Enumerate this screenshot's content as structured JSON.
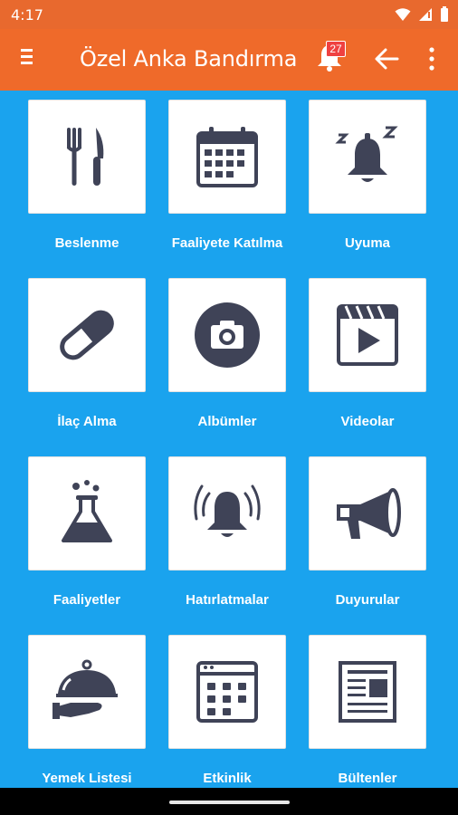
{
  "status": {
    "time": "4:17"
  },
  "appbar": {
    "title": "Özel Anka Bandırma",
    "notification_count": "27"
  },
  "tiles": [
    {
      "label": "Beslenme",
      "icon": "utensils-icon"
    },
    {
      "label": "Faaliyete Katılma",
      "icon": "calendar-icon"
    },
    {
      "label": "Uyuma",
      "icon": "sleep-bell-icon"
    },
    {
      "label": "İlaç Alma",
      "icon": "pill-icon"
    },
    {
      "label": "Albümler",
      "icon": "camera-icon"
    },
    {
      "label": "Videolar",
      "icon": "video-icon"
    },
    {
      "label": "Faaliyetler",
      "icon": "flask-icon"
    },
    {
      "label": "Hatırlatmalar",
      "icon": "alarm-bell-icon"
    },
    {
      "label": "Duyurular",
      "icon": "megaphone-icon"
    },
    {
      "label": "Yemek Listesi",
      "icon": "cloche-icon"
    },
    {
      "label": "Etkinlik",
      "icon": "event-calendar-icon"
    },
    {
      "label": "Bültenler",
      "icon": "newspaper-icon"
    }
  ],
  "colors": {
    "appbar": "#ef6a2a",
    "background": "#1aa3ee",
    "icon": "#3f4357",
    "badge": "#ef4141"
  }
}
